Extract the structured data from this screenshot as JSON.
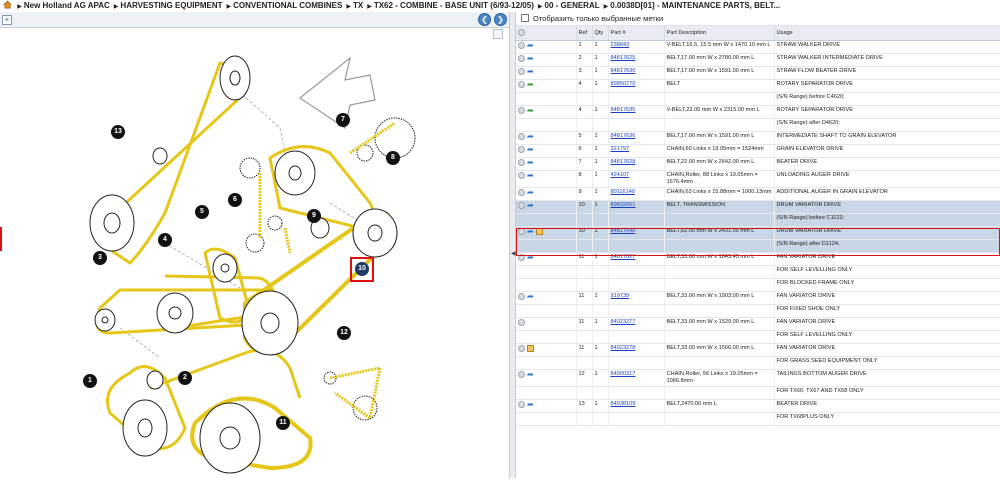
{
  "breadcrumb": [
    "New Holland AG APAC",
    "HARVESTING EQUIPMENT",
    "CONVENTIONAL COMBINES",
    "TX",
    "TX62 - COMBINE - BASE UNIT (6/93-12/05)",
    "00 - GENERAL",
    "0.0038D[01] - MAINTENANCE PARTS, BELT..."
  ],
  "filter": {
    "label": "Отобразить только выбранные метки"
  },
  "columns": {
    "ref": "Ref",
    "qty": "Qty",
    "part": "Part #",
    "desc": "Part Description",
    "usage": "Usage"
  },
  "diagram_labels": [
    "1",
    "2",
    "3",
    "4",
    "5",
    "6",
    "7",
    "8",
    "9",
    "10",
    "11",
    "12",
    "13"
  ],
  "rows": [
    {
      "ref": "1",
      "qty": "1",
      "part": "238843",
      "desc": "V-BELT,16.5, 15.5 mm W x 1470.10 mm L",
      "usage": "STRAW WALKER DRIVE",
      "icon": "blue-arrow"
    },
    {
      "ref": "2",
      "qty": "1",
      "part": "84817625",
      "desc": "BELT,17.00 mm W x 2780.00 mm L",
      "usage": "STRAW WALKER INTERMEDIATE DRIVE",
      "icon": "blue-arrow"
    },
    {
      "ref": "3",
      "qty": "1",
      "part": "84817636",
      "desc": "BELT,17.00 mm W x 1591.00 mm L",
      "usage": "STRAW FLOW BEATER DRIVE",
      "icon": "blue-arrow"
    },
    {
      "ref": "4",
      "qty": "1",
      "part": "89850770",
      "desc": "BELT",
      "usage": "ROTARY SEPARATOR DRIVE",
      "icon": "green-arrow"
    },
    {
      "ref": "",
      "qty": "",
      "part": "",
      "desc": "",
      "usage": "(S/N Range) before C4620;"
    },
    {
      "ref": "4",
      "qty": "1",
      "part": "84817635",
      "desc": "V-BELT,22.00 mm W x 2315.00 mm L",
      "usage": "ROTARY SEPARATOR DRIVE",
      "icon": "green-arrow"
    },
    {
      "ref": "",
      "qty": "",
      "part": "",
      "desc": "",
      "usage": "(S/N Range) after D4620;"
    },
    {
      "ref": "5",
      "qty": "1",
      "part": "84817636",
      "desc": "BELT,17.00 mm W x 1591.00 mm L",
      "usage": "INTERMEDIATE SHAFT TO GRAIN ELEVATOR",
      "icon": "blue-arrow"
    },
    {
      "ref": "6",
      "qty": "1",
      "part": "321797",
      "desc": "CHAIN,60 Links x 19.05mm = 1524mm",
      "usage": "GRAIN ELEVATOR DRIVE",
      "icon": "blue-arrow"
    },
    {
      "ref": "7",
      "qty": "1",
      "part": "84817628",
      "desc": "BELT,22.00 mm W x 2642.00 mm L",
      "usage": "BEATER DRIVE",
      "icon": "blue-arrow"
    },
    {
      "ref": "8",
      "qty": "1",
      "part": "424107",
      "desc": "CHAIN,Roller, 88 Links x 19.05mm = 1676.4mm",
      "usage": "UNLOADING AUGER DRIVE",
      "icon": "blue-arrow",
      "tall": true
    },
    {
      "ref": "9",
      "qty": "1",
      "part": "80116140",
      "desc": "CHAIN,63 Links x 15.88mm = 1000.13mm",
      "usage": "ADDITIONAL AUGER IN GRAIN ELEVATOR",
      "icon": "blue-arrow"
    },
    {
      "ref": "10",
      "qty": "1",
      "part": "89832651",
      "desc": "BELT, TRANSMISSION",
      "usage": "DRUM VARIATOR DRIVE",
      "icon": "blue-arrow",
      "state": "sel"
    },
    {
      "ref": "",
      "qty": "",
      "part": "",
      "desc": "",
      "usage": "(S/N Range) before C1123;",
      "state": "sel"
    },
    {
      "ref": "10",
      "qty": "1",
      "part": "84817640",
      "desc": "BELT,62.00 mm W x 2431.00 mm L",
      "usage": "DRUM VARIATOR DRIVE",
      "icon": "blue-arrow-box",
      "state": "hl"
    },
    {
      "ref": "",
      "qty": "",
      "part": "",
      "desc": "",
      "usage": "(S/N Range) after D1124;",
      "state": "hl"
    },
    {
      "ref": "11",
      "qty": "1",
      "part": "84817627",
      "desc": "BELT,33.00 mm W x 1843.45 mm L",
      "usage": "FAN VARIATOR DRIVE",
      "icon": "blue-arrow"
    },
    {
      "ref": "",
      "qty": "",
      "part": "",
      "desc": "",
      "usage": "FOR SELF LEVELLING ONLY"
    },
    {
      "ref": "",
      "qty": "",
      "part": "",
      "desc": "",
      "usage": "FOR BLOCKED FRAME ONLY"
    },
    {
      "ref": "11",
      "qty": "1",
      "part": "919739",
      "desc": "BELT,33.00 mm W x 1903.00 mm L",
      "usage": "FAN VARIATOR DRIVE",
      "icon": "blue-arrow"
    },
    {
      "ref": "",
      "qty": "",
      "part": "",
      "desc": "",
      "usage": "FOR FIXED SHOE ONLY"
    },
    {
      "ref": "11",
      "qty": "1",
      "part": "84023277",
      "desc": "BELT,33.00 mm W x 1529.00 mm L",
      "usage": "FAN VARIATOR DRIVE",
      "icon": "none"
    },
    {
      "ref": "",
      "qty": "",
      "part": "",
      "desc": "",
      "usage": "FOR SELF LEVELLING ONLY"
    },
    {
      "ref": "11",
      "qty": "1",
      "part": "84023278",
      "desc": "BELT,33.00 mm W x 1566.00 mm L",
      "usage": "FAN VARIATOR DRIVE",
      "icon": "box"
    },
    {
      "ref": "",
      "qty": "",
      "part": "",
      "desc": "",
      "usage": "FOR GRASS SEED EQUIPMENT ONLY"
    },
    {
      "ref": "12",
      "qty": "1",
      "part": "84000317",
      "desc": "CHAIN,Roller, 56 Links x 19.05mm = 1066.8mm",
      "usage": "TAILINGS BOTTOM AUGER DRIVE",
      "icon": "blue-arrow",
      "tall": true
    },
    {
      "ref": "",
      "qty": "",
      "part": "",
      "desc": "",
      "usage": "FOR TX66, TX67 AND TX68 ONLY"
    },
    {
      "ref": "13",
      "qty": "1",
      "part": "84038109",
      "desc": "BELT,2470.00 mm L",
      "usage": "BEATER DRIVE",
      "icon": "blue-arrow"
    },
    {
      "ref": "",
      "qty": "",
      "part": "",
      "desc": "",
      "usage": "FOR TX68PLUS ONLY"
    }
  ]
}
